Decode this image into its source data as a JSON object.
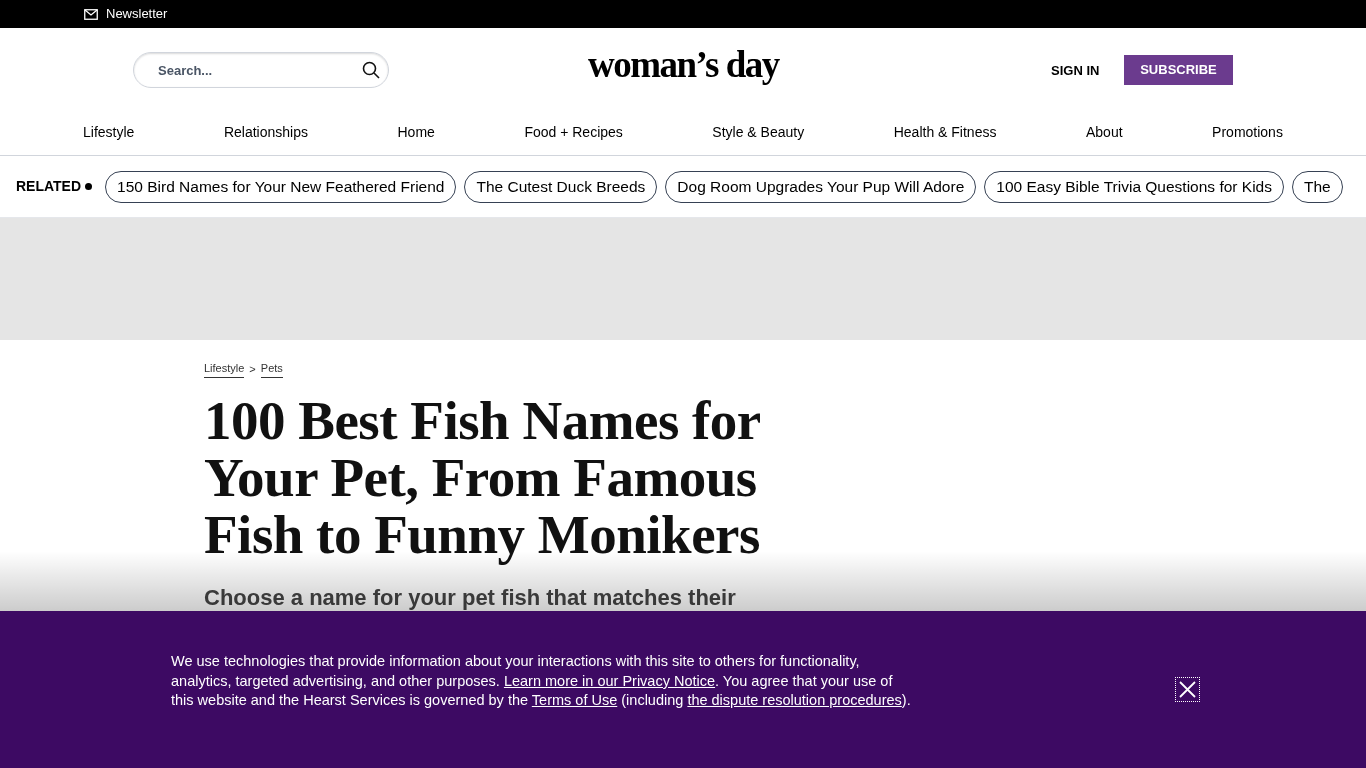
{
  "top_bar": {
    "newsletter": "Newsletter"
  },
  "header": {
    "search": {
      "placeholder": "Search..."
    },
    "logo": "woman’s day",
    "sign_in": "SIGN IN",
    "subscribe": "SUBSCRIBE"
  },
  "nav": [
    "Lifestyle",
    "Relationships",
    "Home",
    "Food + Recipes",
    "Style & Beauty",
    "Health & Fitness",
    "About",
    "Promotions"
  ],
  "related": {
    "label": "RELATED",
    "items": [
      "150 Bird Names for Your New Feathered Friend",
      "The Cutest Duck Breeds",
      "Dog Room Upgrades Your Pup Will Adore",
      "100 Easy Bible Trivia Questions for Kids",
      "The"
    ]
  },
  "article": {
    "breadcrumbs": [
      "Lifestyle",
      "Pets"
    ],
    "breadcrumb_separator": ">",
    "title": "100 Best Fish Names for Your Pet, From Famous Fish to Funny Monikers",
    "subtitle": "Choose a name for your pet fish that matches their"
  },
  "consent_banner": {
    "segments": [
      {
        "text": "We use technologies that provide information about your interactions with this site to others for functionality, analytics, targeted advertising, and other purposes. ",
        "link": false
      },
      {
        "text": "Learn more in our Privacy Notice",
        "link": true
      },
      {
        "text": ". You agree that your use of this website and the Hearst Services is governed by the ",
        "link": false
      },
      {
        "text": "Terms of Use",
        "link": true
      },
      {
        "text": " (including ",
        "link": false
      },
      {
        "text": "the dispute resolution procedures",
        "link": true
      },
      {
        "text": ").",
        "link": false
      }
    ]
  }
}
